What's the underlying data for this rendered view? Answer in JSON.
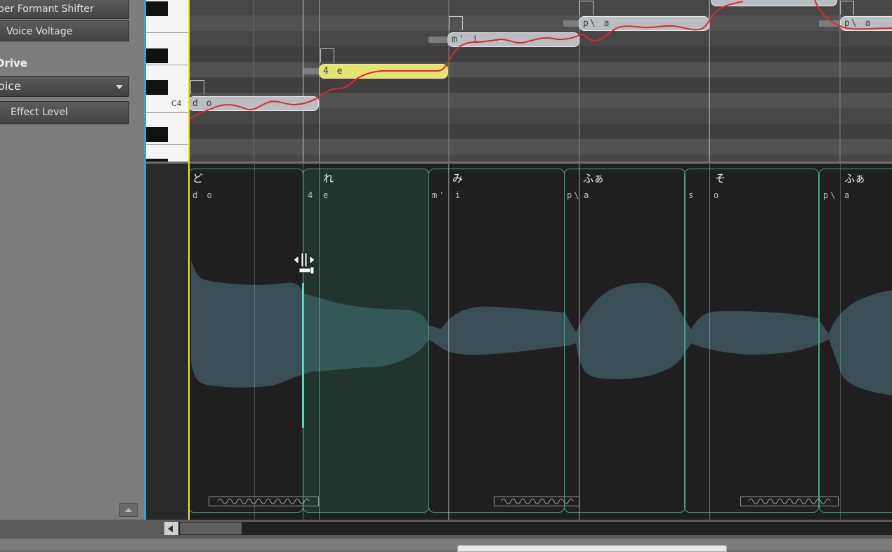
{
  "left_panel": {
    "buttons": [
      "per Formant Shifter",
      "Voice Voltage"
    ],
    "section_label": "Drive",
    "dropdown_value": "oice",
    "effect_button": "Effect Level"
  },
  "piano": {
    "c4_label": "C4"
  },
  "notes": [
    {
      "label": "d o",
      "selected": false
    },
    {
      "label": "4 e",
      "selected": true
    },
    {
      "label": "m' i",
      "selected": false
    },
    {
      "label": "p\\ a",
      "selected": false
    },
    {
      "label": "p\\ a",
      "selected": false
    }
  ],
  "segments": [
    {
      "lyric": "ど",
      "phoneme_pre": "",
      "phoneme": "d o",
      "selected": false
    },
    {
      "lyric": "れ",
      "phoneme_pre": "4",
      "phoneme": "e",
      "selected": true
    },
    {
      "lyric": "み",
      "phoneme_pre": "m'",
      "phoneme": "i",
      "selected": false
    },
    {
      "lyric": "ふぁ",
      "phoneme_pre": "p\\",
      "phoneme": "a",
      "selected": false
    },
    {
      "lyric": "そ",
      "phoneme_pre": "s",
      "phoneme": "o",
      "selected": false
    },
    {
      "lyric": "ふぁ",
      "phoneme_pre": "p\\",
      "phoneme": "a",
      "selected": false
    }
  ],
  "colors": {
    "pitch_curve": "#e0262e",
    "playhead": "#f4e61c",
    "segment_border": "#3ca884",
    "waveform": "#3a4f55",
    "selected_note": "#e4e270",
    "panel_divider": "#2aa7d8"
  },
  "icons": {
    "cursor": "resize-horizontal-cursor-icon",
    "scroll_left": "arrow-left-icon",
    "collapse": "triangle-up-icon"
  }
}
